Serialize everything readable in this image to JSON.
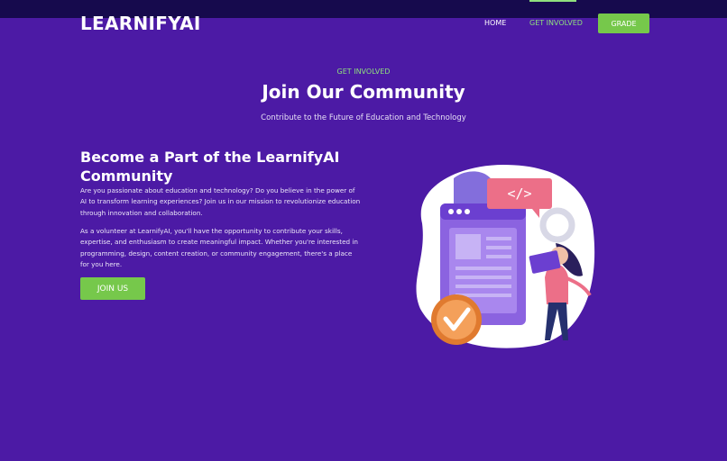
{
  "header": {
    "logo": "LEARNIFYAI",
    "nav": {
      "home": "HOME",
      "get_involved": "GET INVOLVED",
      "grade": "GRADE"
    }
  },
  "hero": {
    "eyebrow": "GET INVOLVED",
    "title": "Join Our Community",
    "subtitle": "Contribute to the Future of Education and Technology"
  },
  "content": {
    "title": "Become a Part of the LearnifyAI Community",
    "paragraph1": "Are you passionate about education and technology? Do you believe in the power of AI to transform learning experiences? Join us in our mission to revolutionize education through innovation and collaboration.",
    "paragraph2": "As a volunteer at LearnifyAI, you'll have the opportunity to contribute your skills, expertise, and enthusiasm to create meaningful impact. Whether you're interested in programming, design, content creation, or community engagement, there's a place for you here.",
    "join_button": "JOIN US"
  },
  "illustration": {
    "code_tag": "</>",
    "icons": [
      "code-window-icon",
      "checkmark-badge-icon",
      "person-with-tablet-icon"
    ]
  },
  "colors": {
    "background": "#4c1aa5",
    "navbar": "#160a4d",
    "accent_green": "#76c84b",
    "link_green": "#8fe07e"
  }
}
